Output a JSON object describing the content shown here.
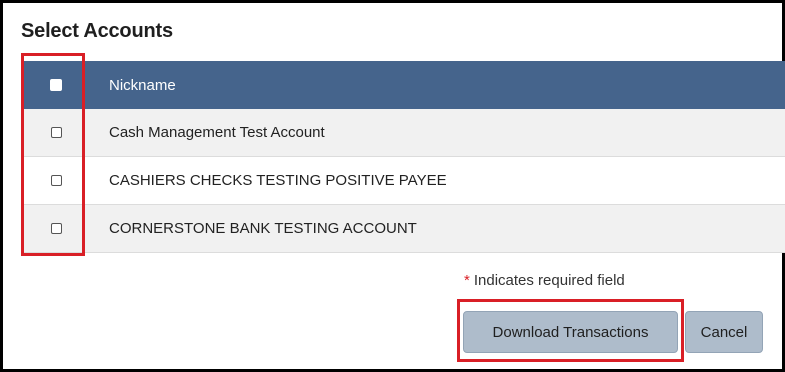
{
  "section_title": "Select Accounts",
  "table": {
    "header": {
      "nickname_label": "Nickname"
    },
    "rows": [
      {
        "nickname": "Cash Management Test Account"
      },
      {
        "nickname": "CASHIERS CHECKS TESTING POSITIVE PAYEE"
      },
      {
        "nickname": "CORNERSTONE BANK TESTING ACCOUNT"
      }
    ]
  },
  "required_note": {
    "star": "*",
    "text": "Indicates required field"
  },
  "buttons": {
    "download_label": "Download Transactions",
    "cancel_label": "Cancel"
  },
  "colors": {
    "header_bg": "#45648c",
    "highlight": "#d91f26",
    "button_bg": "#aebccb"
  }
}
